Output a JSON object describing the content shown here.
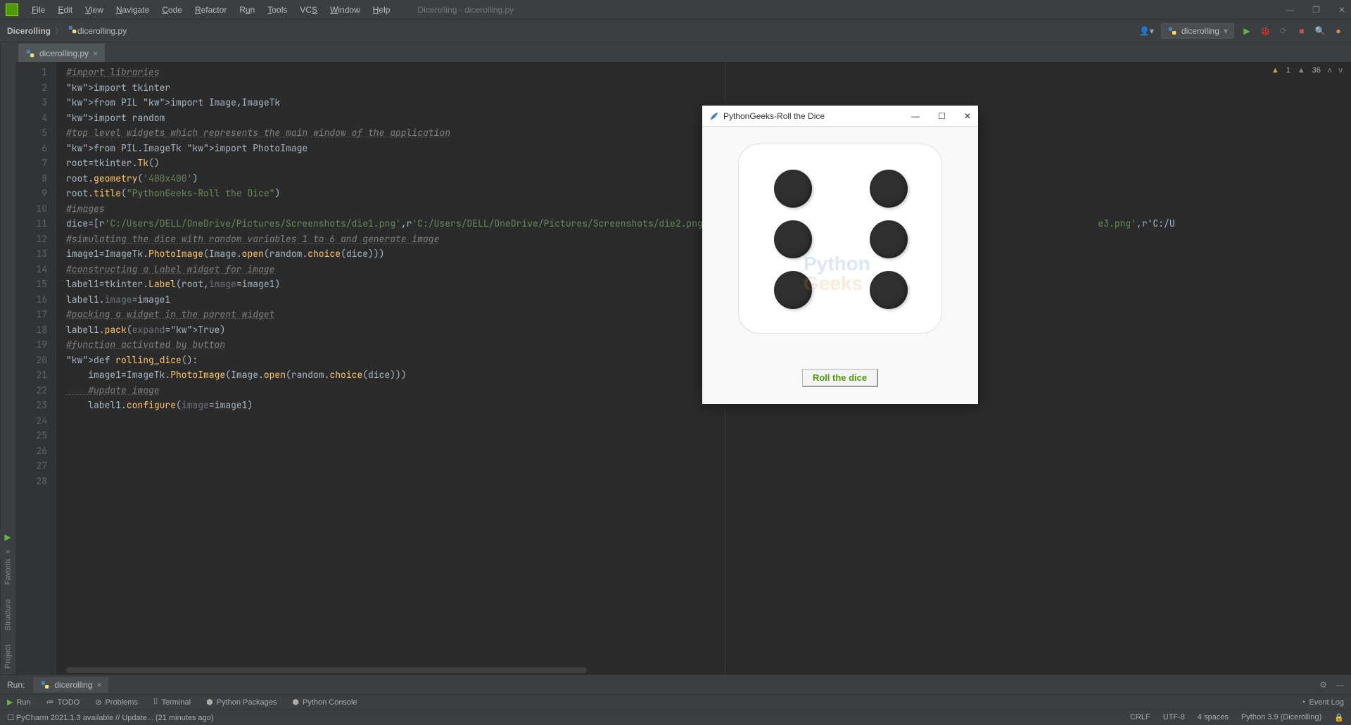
{
  "window_title": "Dicerolling - dicerolling.py",
  "menu": [
    "File",
    "Edit",
    "View",
    "Navigate",
    "Code",
    "Refactor",
    "Run",
    "Tools",
    "VCS",
    "Window",
    "Help"
  ],
  "breadcrumbs": {
    "project": "Dicerolling",
    "file": "dicerolling.py"
  },
  "run_config_name": "dicerolling",
  "editor_tab": "dicerolling.py",
  "inspections": {
    "warnings": "1",
    "typos": "36"
  },
  "code_lines": [
    "#import libraries",
    "import tkinter",
    "from PIL import Image,ImageTk",
    "import random",
    "",
    "#top level widgets which represents the main window of the application",
    "from PIL.ImageTk import PhotoImage",
    "",
    "root=tkinter.Tk()",
    "root.geometry('400x400')",
    "root.title(\"PythonGeeks-Roll the Dice\")",
    "",
    "#images",
    "dice=[r'C:/Users/DELL/OneDrive/Pictures/Screenshots/die1.png',r'C:/Users/DELL/OneDrive/Pictures/Screenshots/die2.png                                                                        e3.png',r'C:/U",
    "",
    "#simulating the dice with random variables 1 to 6 and generate image",
    "image1=ImageTk.PhotoImage(Image.open(random.choice(dice)))",
    "#constructing a Label widget for image",
    "label1=tkinter.Label(root,image=image1)",
    "label1.image=image1",
    "#packing a widget in the parent widget",
    "label1.pack(expand=True)",
    "",
    "#function activated by button",
    "def rolling_dice():",
    "    image1=ImageTk.PhotoImage(Image.open(random.choice(dice)))",
    "    #update image",
    "    label1.configure(image=image1)"
  ],
  "run_panel": {
    "label": "Run:",
    "tab": "dicerolling"
  },
  "bottom_tools": [
    "Run",
    "TODO",
    "Problems",
    "Terminal",
    "Python Packages",
    "Python Console"
  ],
  "event_log": "Event Log",
  "statusbar": {
    "left": "PyCharm 2021.1.3 available // Update... (21 minutes ago)",
    "right": [
      "CRLF",
      "UTF-8",
      "4 spaces",
      "Python 3.9 (Dicerolling)"
    ]
  },
  "left_gutter": [
    "Project",
    "Structure",
    "Favorites"
  ],
  "tk_window": {
    "title": "PythonGeeks-Roll the Dice",
    "button": "Roll the dice",
    "dice_value": 6
  }
}
